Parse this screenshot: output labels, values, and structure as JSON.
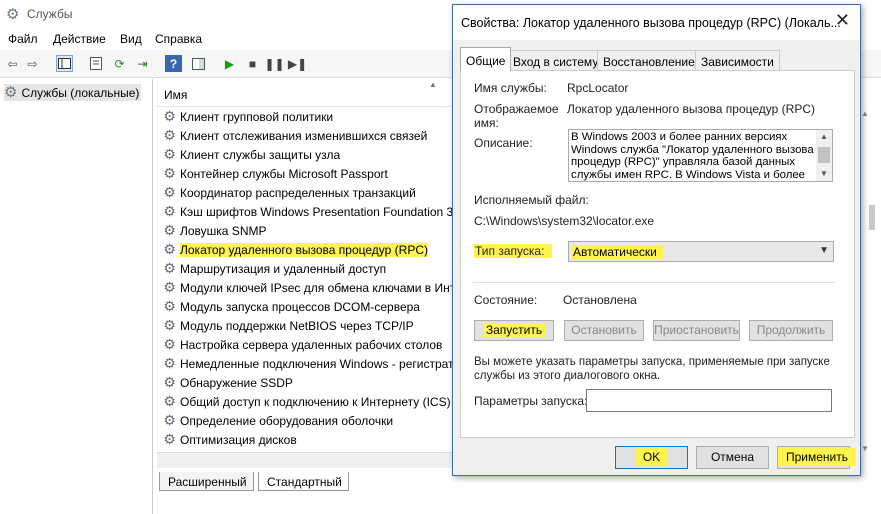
{
  "main": {
    "title": "Службы",
    "menu": [
      "Файл",
      "Действие",
      "Вид",
      "Справка"
    ],
    "tree_root": "Службы (локальные)",
    "column_header": "Имя",
    "services": [
      "Клиент групповой политики",
      "Клиент отслеживания изменившихся связей",
      "Клиент службы защиты узла",
      "Контейнер службы Microsoft Passport",
      "Координатор распределенных транзакций",
      "Кэш шрифтов Windows Presentation Foundation 3",
      "Ловушка SNMP",
      "Локатор удаленного вызова процедур (RPC)",
      "Маршрутизация и удаленный доступ",
      "Модули ключей IPsec для обмена ключами в Инт",
      "Модуль запуска процессов DCOM-сервера",
      "Модуль поддержки NetBIOS через TCP/IP",
      "Настройка сервера удаленных рабочих столов",
      "Немедленные подключения Windows - регистрат",
      "Обнаружение SSDP",
      "Общий доступ к подключению к Интернету (ICS)",
      "Определение оборудования оболочки",
      "Оптимизация дисков"
    ],
    "selected_index": 7,
    "bottom_tabs": [
      "Расширенный",
      "Стандартный"
    ]
  },
  "dialog": {
    "title": "Свойства: Локатор удаленного вызова процедур (RPC) (Локаль...",
    "close_symbol": "✕",
    "tabs": [
      "Общие",
      "Вход в систему",
      "Восстановление",
      "Зависимости"
    ],
    "service_name_label": "Имя службы:",
    "service_name": "RpcLocator",
    "display_name_label": "Отображаемое\nимя:",
    "display_name": "Локатор удаленного вызова процедур (RPC)",
    "description_label": "Описание:",
    "description": "В Windows 2003 и более ранних версиях Windows служба \"Локатор удаленного вызова процедур (RPC)\" управляла базой данных службы имен RPC. В Windows Vista и более",
    "exe_label": "Исполняемый файл:",
    "exe_path": "C:\\Windows\\system32\\locator.exe",
    "startup_type_label": "Тип запуска:",
    "startup_type": "Автоматически",
    "status_label": "Состояние:",
    "status_value": "Остановлена",
    "buttons": {
      "start": "Запустить",
      "stop": "Остановить",
      "pause": "Приостановить",
      "resume": "Продолжить"
    },
    "hint": "Вы можете указать параметры запуска, применяемые при запуске службы из этого диалогового окна.",
    "params_label": "Параметры запуска:",
    "params_value": "",
    "ok": "OK",
    "cancel": "Отмена",
    "apply": "Применить"
  },
  "colors": {
    "highlight": "#fff44f",
    "accent": "#0078d7"
  }
}
